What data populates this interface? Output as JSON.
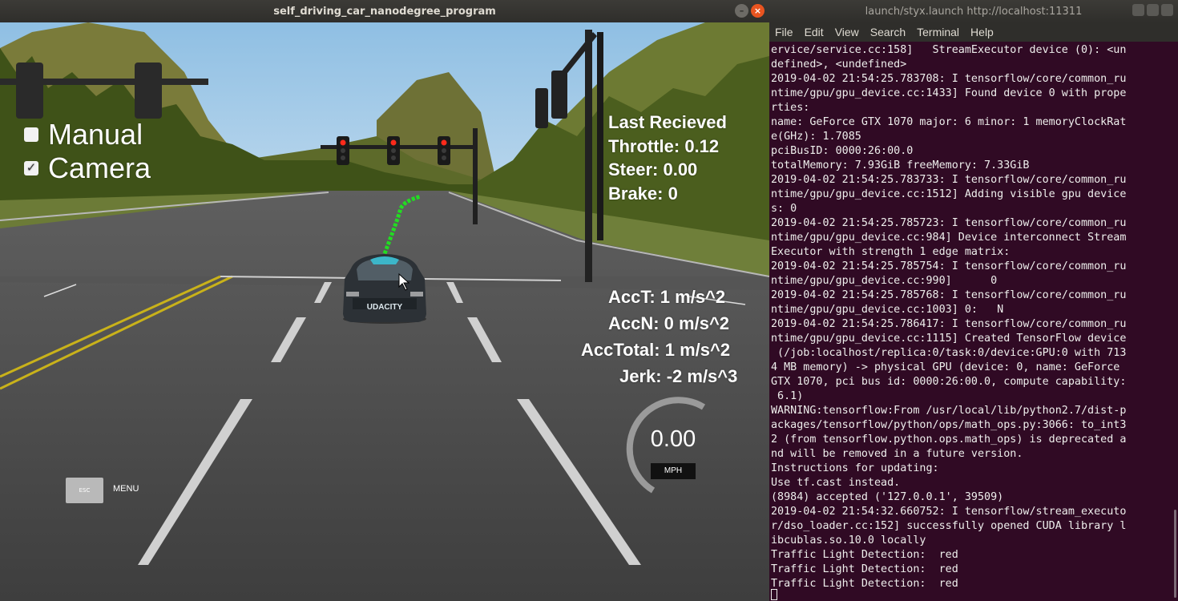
{
  "sim_window": {
    "title": "self_driving_car_nanodegree_program",
    "buttons": {
      "minimize": "–",
      "close": "×"
    }
  },
  "hud": {
    "manual": {
      "label": "Manual",
      "checked": false
    },
    "camera": {
      "label": "Camera",
      "checked": true,
      "check_glyph": "✓"
    },
    "last_received": "Last Recieved",
    "throttle": "Throttle: 0.12",
    "steer": "Steer: 0.00",
    "brake": "Brake: 0",
    "acc_t": "AccT: 1 m/s^2",
    "acc_n": "AccN: 0 m/s^2",
    "acc_total": "AccTotal: 1 m/s^2",
    "jerk": "Jerk: -2 m/s^3",
    "esc_key": "ESC",
    "menu": "MENU",
    "speed": "0.00",
    "speed_unit": "MPH",
    "car_brand": "UDACITY"
  },
  "traffic_lights_state": "red",
  "term_window": {
    "title": "launch/styx.launch http://localhost:11311",
    "menu": [
      "File",
      "Edit",
      "View",
      "Search",
      "Terminal",
      "Help"
    ],
    "lines": [
      "ervice/service.cc:158]   StreamExecutor device (0): <un",
      "defined>, <undefined>",
      "2019-04-02 21:54:25.783708: I tensorflow/core/common_ru",
      "ntime/gpu/gpu_device.cc:1433] Found device 0 with prope",
      "rties:",
      "name: GeForce GTX 1070 major: 6 minor: 1 memoryClockRat",
      "e(GHz): 1.7085",
      "pciBusID: 0000:26:00.0",
      "totalMemory: 7.93GiB freeMemory: 7.33GiB",
      "2019-04-02 21:54:25.783733: I tensorflow/core/common_ru",
      "ntime/gpu/gpu_device.cc:1512] Adding visible gpu device",
      "s: 0",
      "2019-04-02 21:54:25.785723: I tensorflow/core/common_ru",
      "ntime/gpu/gpu_device.cc:984] Device interconnect Stream",
      "Executor with strength 1 edge matrix:",
      "2019-04-02 21:54:25.785754: I tensorflow/core/common_ru",
      "ntime/gpu/gpu_device.cc:990]      0",
      "2019-04-02 21:54:25.785768: I tensorflow/core/common_ru",
      "ntime/gpu/gpu_device.cc:1003] 0:   N",
      "2019-04-02 21:54:25.786417: I tensorflow/core/common_ru",
      "ntime/gpu/gpu_device.cc:1115] Created TensorFlow device",
      " (/job:localhost/replica:0/task:0/device:GPU:0 with 713",
      "4 MB memory) -> physical GPU (device: 0, name: GeForce ",
      "GTX 1070, pci bus id: 0000:26:00.0, compute capability:",
      " 6.1)",
      "WARNING:tensorflow:From /usr/local/lib/python2.7/dist-p",
      "ackages/tensorflow/python/ops/math_ops.py:3066: to_int3",
      "2 (from tensorflow.python.ops.math_ops) is deprecated a",
      "nd will be removed in a future version.",
      "Instructions for updating:",
      "Use tf.cast instead.",
      "(8984) accepted ('127.0.0.1', 39509)",
      "2019-04-02 21:54:32.660752: I tensorflow/stream_executo",
      "r/dso_loader.cc:152] successfully opened CUDA library l",
      "ibcublas.so.10.0 locally",
      "Traffic Light Detection:  red",
      "Traffic Light Detection:  red",
      "Traffic Light Detection:  red"
    ]
  },
  "colors": {
    "terminal_bg": "#300a24",
    "terminal_fg": "#eeeeec",
    "close_button": "#e95420",
    "waypoints": "#22dd22",
    "sky": "#9ec7e6",
    "light_red": "#ff2a1a"
  }
}
